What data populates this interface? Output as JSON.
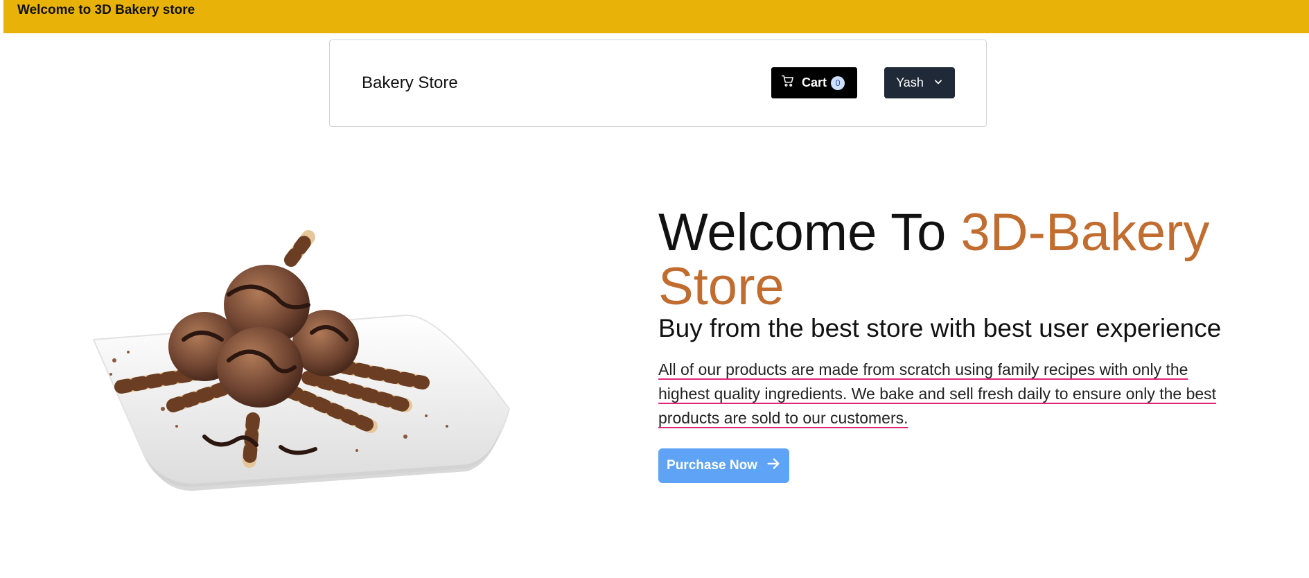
{
  "banner": {
    "text": "Welcome to 3D Bakery store"
  },
  "navbar": {
    "brand": "Bakery Store",
    "cart": {
      "label": "Cart",
      "count": "0",
      "icon": "cart-icon"
    },
    "user": {
      "name": "Yash",
      "icon": "chevron-down-icon"
    }
  },
  "hero": {
    "image_alt": "chocolate-ice-cream-dessert-image",
    "title_part1": "Welcome To ",
    "title_accent": "3D-Bakery Store",
    "subtitle": "Buy from the best store with best user experience",
    "description": "All of our products are made from scratch using family recipes with only the highest quality ingredients. We bake and sell fresh daily to ensure only the best products are sold to our customers.",
    "cta_label": "Purchase Now",
    "cta_icon": "arrow-right-icon"
  },
  "colors": {
    "banner": "#e9b208",
    "accent": "#c06d2f",
    "cta": "#5ea3f5",
    "user_button": "#1f2937",
    "underline": "#e0247c"
  }
}
